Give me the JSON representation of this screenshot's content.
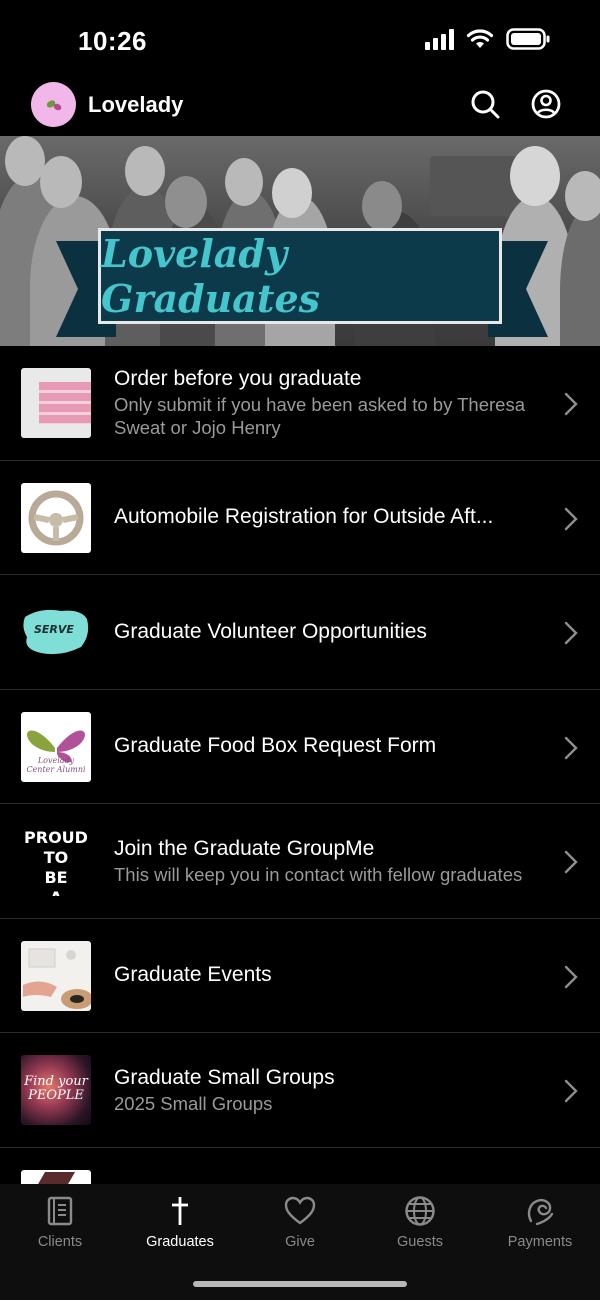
{
  "status_bar": {
    "time": "10:26"
  },
  "header": {
    "title": "Lovelady",
    "search_icon": "search-icon",
    "account_icon": "account-icon"
  },
  "banner": {
    "text": "Lovelady Graduates"
  },
  "list": {
    "items": [
      {
        "title": "Order before you graduate",
        "subtitle": "Only submit if you have been asked to by Theresa Sweat or Jojo Henry"
      },
      {
        "title": "Automobile Registration for Outside Aft...",
        "subtitle": ""
      },
      {
        "title": "Graduate Volunteer Opportunities",
        "subtitle": "",
        "thumb_text": "SERVE"
      },
      {
        "title": "Graduate Food Box Request Form",
        "subtitle": "",
        "thumb_text": "Lovelady Center Alumni"
      },
      {
        "title": "Join the Graduate GroupMe",
        "subtitle": "This will keep you in contact with fellow graduates",
        "thumb_text": "PROUD TO BE A LOVELADY"
      },
      {
        "title": "Graduate Events",
        "subtitle": ""
      },
      {
        "title": "Graduate Small Groups",
        "subtitle": "2025 Small Groups",
        "thumb_text": "Find your PEOPLE"
      }
    ]
  },
  "tabs": [
    {
      "label": "Clients",
      "icon": "book-icon"
    },
    {
      "label": "Graduates",
      "icon": "cross-icon",
      "active": true
    },
    {
      "label": "Give",
      "icon": "heart-icon"
    },
    {
      "label": "Guests",
      "icon": "globe-icon"
    },
    {
      "label": "Payments",
      "icon": "payments-icon"
    }
  ],
  "colors": {
    "background": "#000000",
    "banner_ribbon": "#0d3a4a",
    "banner_text": "#45c5cc",
    "avatar_bg": "#f1b7e9"
  }
}
